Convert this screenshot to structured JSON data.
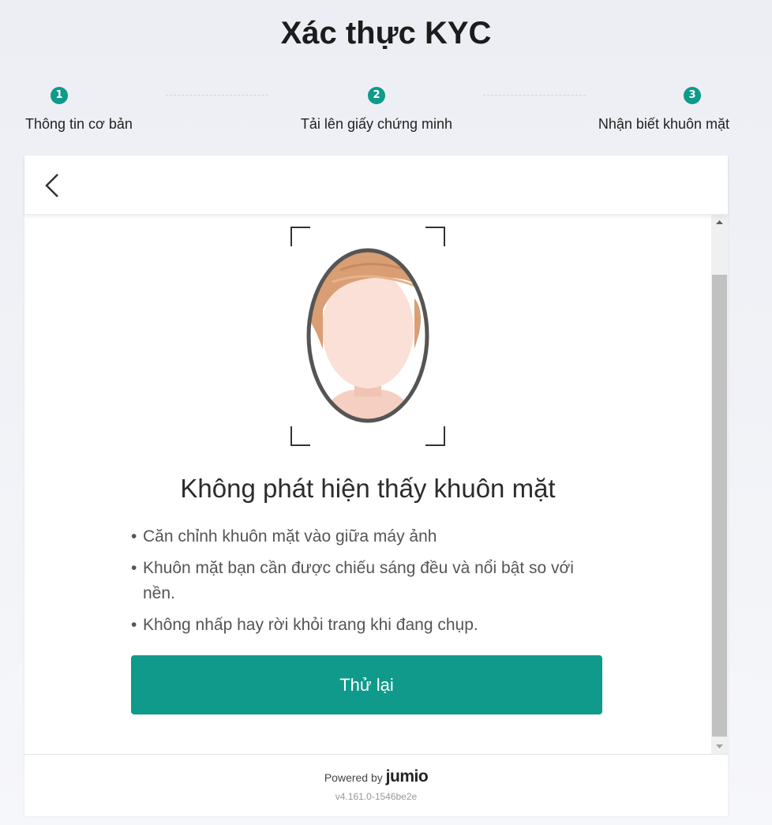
{
  "page": {
    "title": "Xác thực KYC"
  },
  "steps": [
    {
      "number": "1",
      "label": "Thông tin cơ bản"
    },
    {
      "number": "2",
      "label": "Tải lên giấy chứng minh"
    },
    {
      "number": "3",
      "label": "Nhận biết khuôn mặt"
    }
  ],
  "header": {
    "back_icon": "chevron-left-icon"
  },
  "face_illustration": {
    "icon": "face-outline-icon"
  },
  "message": {
    "heading": "Không phát hiện thấy khuôn mặt",
    "tips": [
      "Căn chỉnh khuôn mặt vào giữa máy ảnh",
      "Khuôn mặt bạn cần được chiếu sáng đều và nổi bật so với nền.",
      "Không nhấp hay rời khỏi trang khi đang chụp."
    ]
  },
  "retry_button": {
    "label": "Thử lại"
  },
  "footer": {
    "powered_by": "Powered by",
    "brand": "jumio",
    "version": "v4.161.0-1546be2e"
  },
  "colors": {
    "accent": "#0f9a8b",
    "background": "#eceef4"
  }
}
